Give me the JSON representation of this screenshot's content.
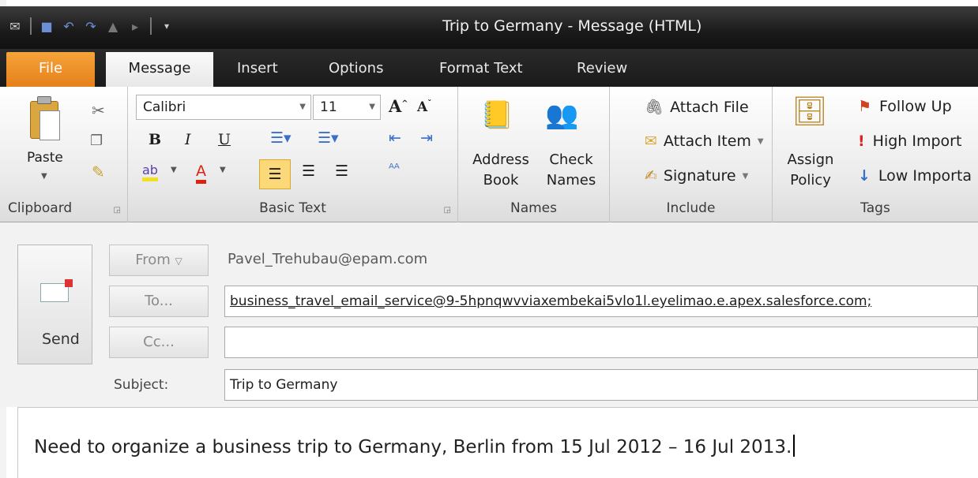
{
  "window": {
    "title": "Trip to Germany  -  Message (HTML)"
  },
  "ribbon": {
    "tabs": [
      "File",
      "Message",
      "Insert",
      "Options",
      "Format Text",
      "Review"
    ],
    "active_tab": "Message",
    "clipboard": {
      "paste_label": "Paste",
      "group_label": "Clipboard"
    },
    "basic_text": {
      "font_name": "Calibri",
      "font_size": "11",
      "group_label": "Basic Text",
      "bold": "B",
      "italic": "I",
      "underline": "U"
    },
    "names": {
      "address_book": [
        "Address",
        "Book"
      ],
      "check_names": [
        "Check",
        "Names"
      ],
      "group_label": "Names"
    },
    "include": {
      "attach_file": "Attach File",
      "attach_item": "Attach Item",
      "signature": "Signature",
      "group_label": "Include"
    },
    "tags": {
      "assign_policy": [
        "Assign",
        "Policy"
      ],
      "follow_up": "Follow Up",
      "high_importance": "High Import",
      "low_importance": "Low Importa",
      "group_label": "Tags"
    }
  },
  "header": {
    "send_label": "Send",
    "from_button": "From",
    "from_value": "Pavel_Trehubau@epam.com",
    "to_button": "To...",
    "to_value": "business_travel_email_service@9-5hpnqwvviaxembekai5vlo1l.eyelimao.e.apex.salesforce.com;",
    "cc_button": "Cc...",
    "cc_value": "",
    "subject_label": "Subject:",
    "subject_value": "Trip to Germany"
  },
  "body": {
    "text": "Need to organize a business trip to Germany, Berlin from 15 Jul 2012 – 16 Jul 2013."
  },
  "colors": {
    "file_tab": "#e6801b",
    "titlebar": "#1a1a1a",
    "ribbon": "#eaeaea"
  }
}
